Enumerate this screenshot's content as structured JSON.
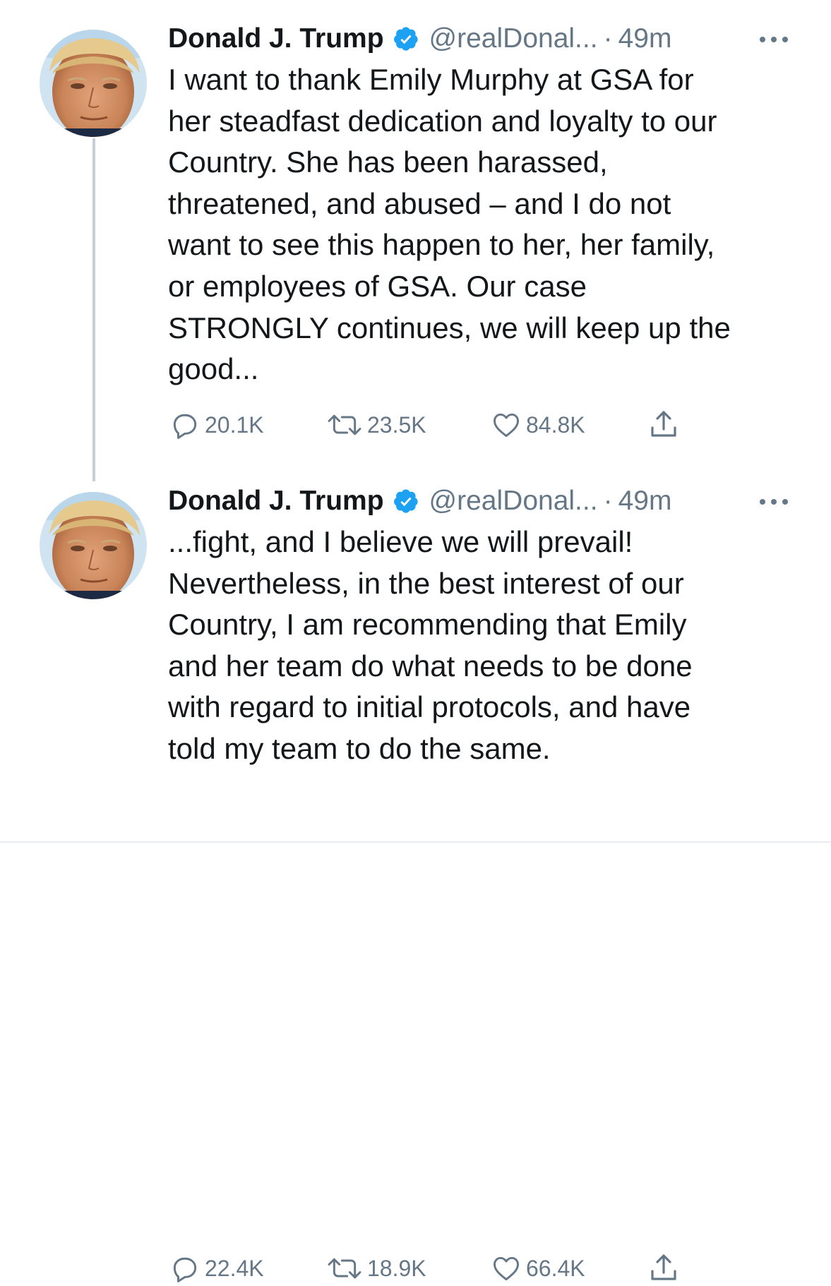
{
  "colors": {
    "text": "#14171a",
    "secondary": "#657786",
    "verified": "#1da1f2",
    "thread_line": "#c4cfd6"
  },
  "tweets": [
    {
      "display_name": "Donald J. Trump",
      "verified_icon": "verified-badge-icon",
      "handle": "@realDonal...",
      "separator": "·",
      "time": "49m",
      "more_icon": "more-horizontal-icon",
      "text_lines": [
        "I want to thank Emily Murphy at GSA for",
        "her steadfast dedication and loyalty to our",
        "Country. She has been harassed,",
        "threatened, and abused – and I do not",
        "want to see this happen to her, her family,",
        "or employees of GSA. Our case",
        "STRONGLY continues, we will keep up the",
        "good..."
      ],
      "replies": "20.1K",
      "retweets": "23.5K",
      "likes": "84.8K"
    },
    {
      "display_name": "Donald J. Trump",
      "verified_icon": "verified-badge-icon",
      "handle": "@realDonal...",
      "separator": "·",
      "time": "49m",
      "more_icon": "more-horizontal-icon",
      "text_lines": [
        "...fight, and I believe we will prevail!",
        "Nevertheless, in the best interest of our",
        "Country, I am recommending that Emily",
        "and her team do what needs to be done",
        "with regard to initial protocols, and have",
        "told my team to do the same."
      ],
      "replies": "22.4K",
      "retweets": "18.9K",
      "likes": "66.4K"
    }
  ]
}
